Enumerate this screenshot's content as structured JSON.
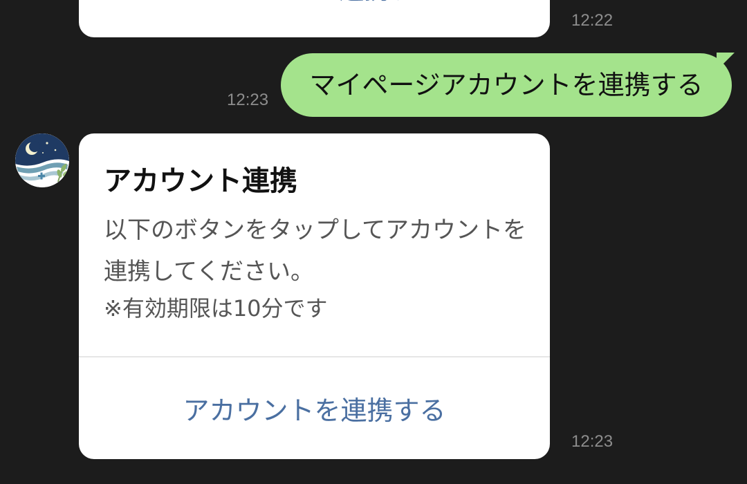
{
  "messages": {
    "prev_card": {
      "button_label": "アカウントを連携する",
      "time": "12:22"
    },
    "user": {
      "text": "マイページアカウントを連携する",
      "time": "12:23"
    },
    "bot_card": {
      "avatar_icon": "moon-wave-leaf-logo",
      "title": "アカウント連携",
      "body": "以下のボタンをタップしてアカウントを連携してください。",
      "note": "※有効期限は10分です",
      "button_label": "アカウントを連携する",
      "time": "12:23"
    }
  },
  "colors": {
    "background": "#1c1c1c",
    "user_bubble": "#a4e38c",
    "card": "#ffffff",
    "link": "#4a6fa1",
    "timestamp": "#8d8d8d"
  }
}
